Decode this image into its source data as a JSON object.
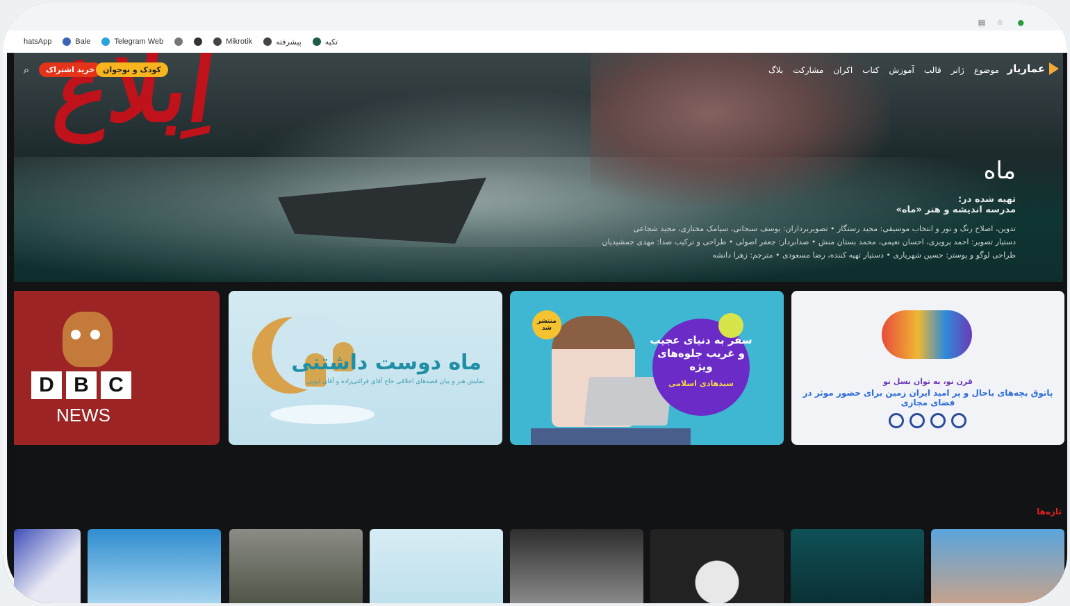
{
  "browser": {
    "bookmarks": [
      {
        "label": "hatsApp",
        "icon": "whatsapp-icon",
        "color": "#25d366"
      },
      {
        "label": "Bale",
        "icon": "bale-icon",
        "color": "#3b66b8"
      },
      {
        "label": "Telegram Web",
        "icon": "telegram-icon",
        "color": "#2aa3dd"
      },
      {
        "label": "",
        "icon": "link-icon",
        "color": "#555555"
      },
      {
        "label": "",
        "icon": "openai-icon",
        "color": "#333333"
      },
      {
        "label": "Mikrotik",
        "icon": "globe-icon",
        "color": "#444444"
      },
      {
        "label": "پیشرفته",
        "icon": "globe-icon",
        "color": "#444444"
      },
      {
        "label": "تکیه",
        "icon": "tekye-icon",
        "color": "#1e5d49"
      }
    ]
  },
  "site": {
    "brand": "عماریار",
    "menu": [
      "موضوع",
      "ژانر",
      "قالب",
      "آموزش",
      "کتاب",
      "اکران",
      "مشارکت",
      "بلاگ"
    ],
    "kids_button": "کودک و نوجوان",
    "subscribe_button": "خرید اشتراک"
  },
  "hero": {
    "title_art": "اِبلاغ",
    "logo_mark": "ماه",
    "made_by_label": "تهیه شده در:",
    "school": "مدرسه اندیشه و هنر «ماه»",
    "credits": [
      "تدوین، اصلاح رنگ و نور و انتخاب موسیقی: مجید رستگار • تصویربرداران: یوسف سبحانی، سیامک مختاری، مجید شجاعی",
      "دستیار تصویر: احمد پرویزی، احسان نعیمی، محمد بستان منش • صدابردار: جعفر اصولی • طراحی و ترکیب صدا: مهدی جمشیدیان",
      "طراحی لوگو و پوستر: حسین شهریاری • دستیار تهیه کننده، رضا مسعودی • مترجم: زهرا دانشه"
    ]
  },
  "banners": {
    "bbc": {
      "letters": [
        "D",
        "B",
        "C"
      ],
      "news": "NEWS"
    },
    "moon": {
      "title": "ماه دوست داشتنی",
      "subtitle": "نمایش هنر و بیان قصه‌های اخلاقی حاج آقای قرائتی‌زاده و آقای ایوبی"
    },
    "promo": {
      "badge": "منتشر شد",
      "text": "سفر به دنیای عجیب و غریب جلوه‌های ویژه",
      "name": "سیدهادی اسلامی"
    },
    "tavan": {
      "line1": "قرن نو، به توان نسل نو",
      "line2": "پاتوق بچه‌های باحال و پر امید ایران زمین برای حضور موثر در فضای مجازی"
    }
  },
  "sections": {
    "new_label": "تازه‌ها"
  }
}
